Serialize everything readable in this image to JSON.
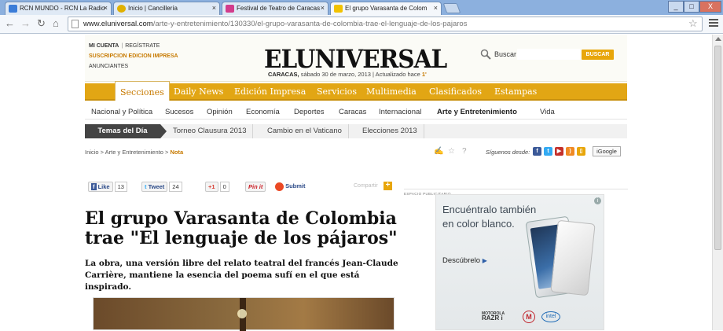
{
  "browser": {
    "tabs": [
      {
        "title": "RCN MUNDO - RCN La Radio",
        "favicon_color": "#3b7dd8"
      },
      {
        "title": "Inicio | Cancillería",
        "favicon_color": "#e0b000"
      },
      {
        "title": "Festival de Teatro de Caracas",
        "favicon_color": "#d23c8c"
      },
      {
        "title": "El grupo Varasanta de Colom",
        "favicon_color": "#f2c200"
      }
    ],
    "url_host": "www.eluniversal.com",
    "url_path": "/arte-y-entretenimiento/130330/el-grupo-varasanta-de-colombia-trae-el-lenguaje-de-los-pajaros",
    "close_glyph": "×",
    "window_buttons": [
      "_",
      "□",
      "X"
    ]
  },
  "header": {
    "mi_cuenta": "MI CUENTA",
    "registrate": "REGÍSTRATE",
    "suscripcion": "SUSCRIPCION EDICION IMPRESA",
    "anunciantes": "ANUNCIANTES",
    "logo": "ELUNIVERSAL",
    "city": "CARACAS,",
    "date": "sábado 30 de marzo, 2013",
    "updated": "Actualizado hace",
    "updated_value": "1'",
    "search_label": "Buscar",
    "search_button": "BUSCAR"
  },
  "sections": [
    "Secciones",
    "Daily News",
    "Edición Impresa",
    "Servicios",
    "Multimedia",
    "Clasificados",
    "Estampas"
  ],
  "subnav": [
    "Nacional y Política",
    "Sucesos",
    "Opinión",
    "Economía",
    "Deportes",
    "Caracas",
    "Internacional",
    "Arte y Entretenimiento",
    "Vida"
  ],
  "temas": {
    "title": "Temas del Día",
    "items": [
      "Torneo Clausura 2013",
      "Cambio en el Vaticano",
      "Elecciones 2013"
    ]
  },
  "breadcrumb": {
    "inicio": "Inicio",
    "section": "Arte y Entretenimiento",
    "current": "Nota",
    "sep": ">"
  },
  "follow_label": "Síguenos desde:",
  "igoogle": "iGoogle",
  "share": {
    "like": "Like",
    "like_count": "13",
    "tweet": "Tweet",
    "tweet_count": "24",
    "gplus": "+1",
    "gplus_count": "0",
    "pinit": "Pin it",
    "submit": "Submit",
    "compartir": "Compartir",
    "plus": "+"
  },
  "article": {
    "headline": "El grupo Varasanta de Colombia trae \"El lenguaje de los pájaros\"",
    "lead": "La obra, una versión libre del relato teatral del francés Jean-Claude Carrière, mantiene la esencia del poema sufí en el que está inspirado."
  },
  "ad": {
    "label": "ESPACIO PUBLICITARIO",
    "line1": "Encuéntralo también",
    "line2": "en color blanco.",
    "cta": "Descúbrelo",
    "brand_small": "MOTOROLA",
    "brand_model": "RAZR i",
    "intel": "intel"
  }
}
